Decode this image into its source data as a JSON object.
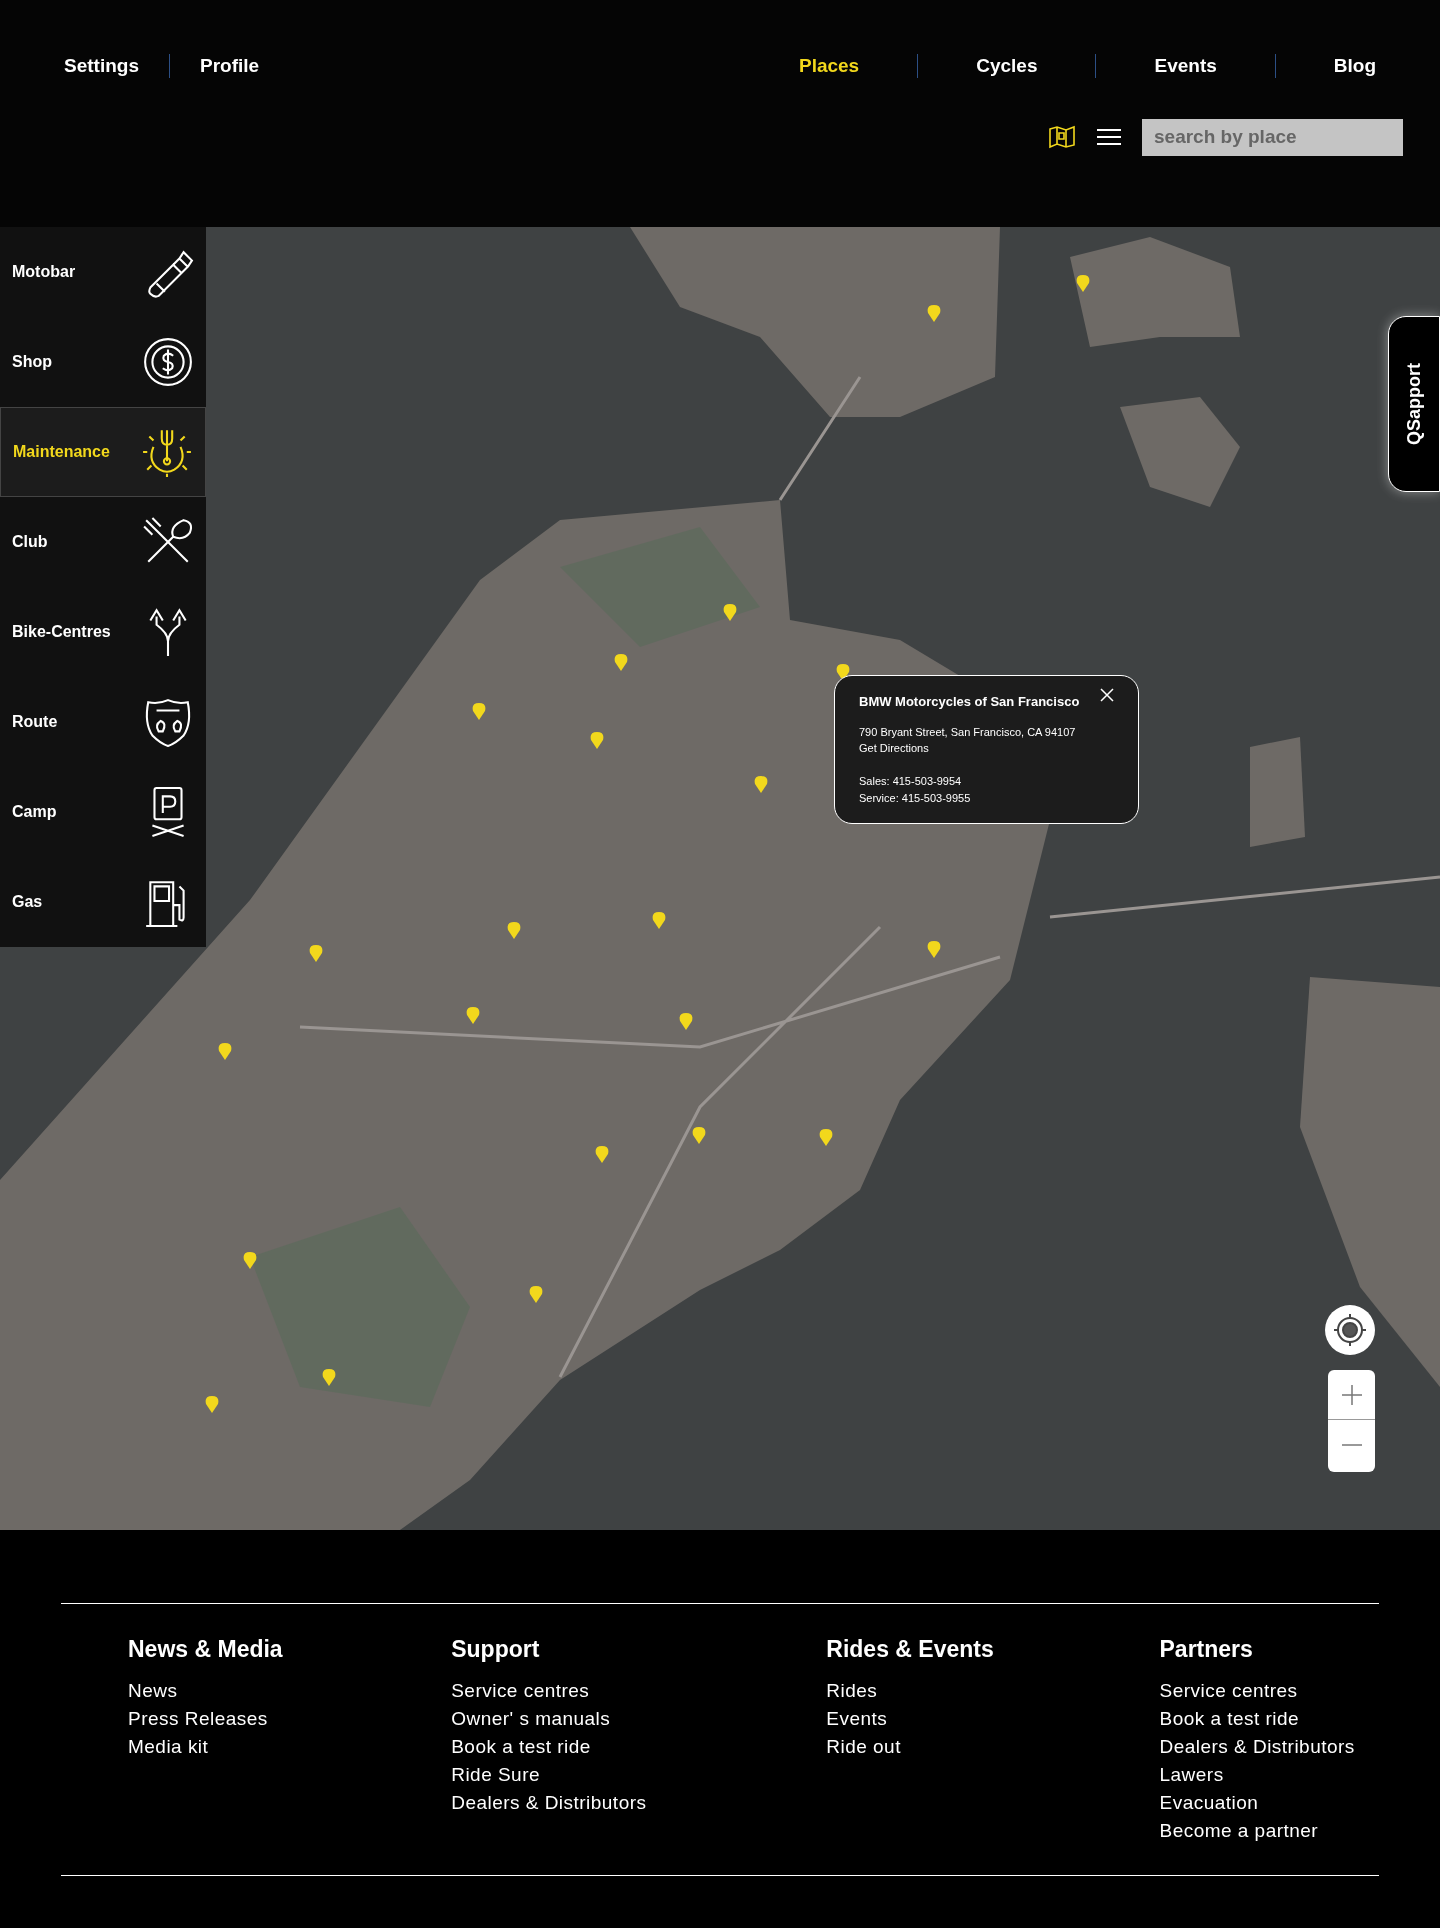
{
  "nav_left": [
    {
      "label": "Settings",
      "selected": false
    },
    {
      "label": "Profile",
      "selected": false
    }
  ],
  "nav_right": [
    {
      "label": "Places",
      "selected": true
    },
    {
      "label": "Cycles",
      "selected": false
    },
    {
      "label": "Events",
      "selected": false
    },
    {
      "label": "Blog",
      "selected": false
    }
  ],
  "search": {
    "placeholder": "search by place"
  },
  "categories": [
    {
      "label": "Motobar",
      "selected": false
    },
    {
      "label": "Shop",
      "selected": false
    },
    {
      "label": "Maintenance",
      "selected": true
    },
    {
      "label": "Club",
      "selected": false
    },
    {
      "label": "Bike-Centres",
      "selected": false
    },
    {
      "label": "Route",
      "selected": false
    },
    {
      "label": "Camp",
      "selected": false
    },
    {
      "label": "Gas",
      "selected": false
    }
  ],
  "popup": {
    "title": "BMW Motorcycles of San Francisco",
    "address": "790 Bryant Street, San Francisco, CA 94107",
    "link": "Get Directions",
    "lines": [
      "Sales: 415-503-9954",
      "Service: 415-503-9955"
    ]
  },
  "support_tab": {
    "label": "QSapport"
  },
  "footer": {
    "columns": [
      {
        "heading": "News & Media",
        "links": [
          "News",
          "Press Releases",
          "Media kit"
        ]
      },
      {
        "heading": "Support",
        "links": [
          "Service centres",
          "Owner' s manuals",
          "Book a test ride",
          "Ride Sure",
          "Dealers  & Distributors"
        ]
      },
      {
        "heading": "Rides & Events",
        "links": [
          "Rides",
          "Events",
          "Ride out"
        ]
      },
      {
        "heading": "Partners",
        "links": [
          "Service centres",
          "Book a test ride",
          "Dealers  & Distributors",
          "Lawers",
          "Evacuation",
          "Become a partner"
        ]
      }
    ]
  }
}
